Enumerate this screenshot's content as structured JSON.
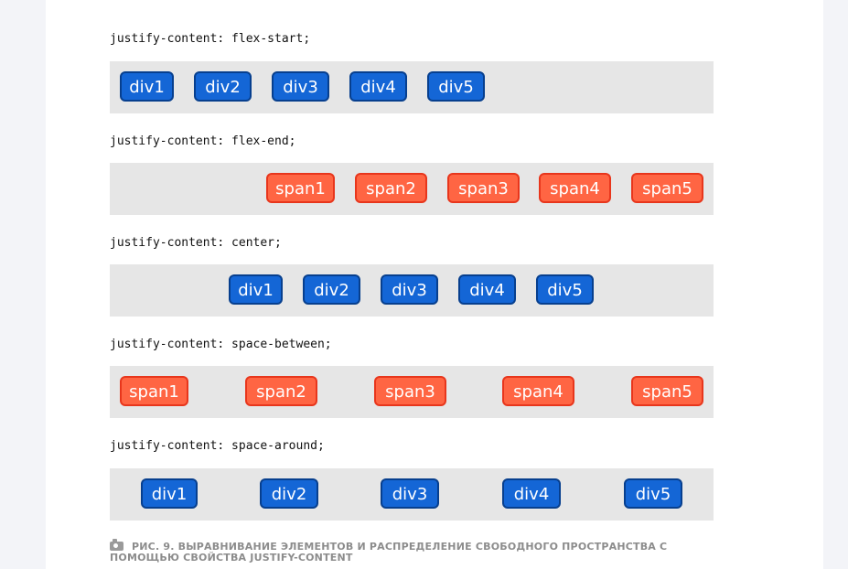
{
  "examples": [
    {
      "code": "justify-content: flex-start;",
      "kind": "div",
      "items": [
        "div1",
        "div2",
        "div3",
        "div4",
        "div5"
      ]
    },
    {
      "code": "justify-content: flex-end;",
      "kind": "span",
      "items": [
        "span1",
        "span2",
        "span3",
        "span4",
        "span5"
      ]
    },
    {
      "code": "justify-content: center;",
      "kind": "div",
      "items": [
        "div1",
        "div2",
        "div3",
        "div4",
        "div5"
      ]
    },
    {
      "code": "justify-content: space-between;",
      "kind": "span",
      "items": [
        "span1",
        "span2",
        "span3",
        "span4",
        "span5"
      ]
    },
    {
      "code": "justify-content: space-around;",
      "kind": "div",
      "items": [
        "div1",
        "div2",
        "div3",
        "div4",
        "div5"
      ]
    }
  ],
  "caption": {
    "icon": "camera-icon",
    "text": "РИС. 9. ВЫРАВНИВАНИЕ ЭЛЕМЕНТОВ И РАСПРЕДЕЛЕНИЕ СВОБОДНОГО ПРОСТРАНСТВА С ПОМОЩЬЮ СВОЙСТВА JUSTIFY-CONTENT"
  },
  "colors": {
    "div_fill": "#1466d6",
    "div_border": "#073f8e",
    "span_fill": "#ff6543",
    "span_border": "#e8361c",
    "container": "#e6e6e6",
    "page": "#f3f4f8",
    "card": "#ffffff"
  }
}
